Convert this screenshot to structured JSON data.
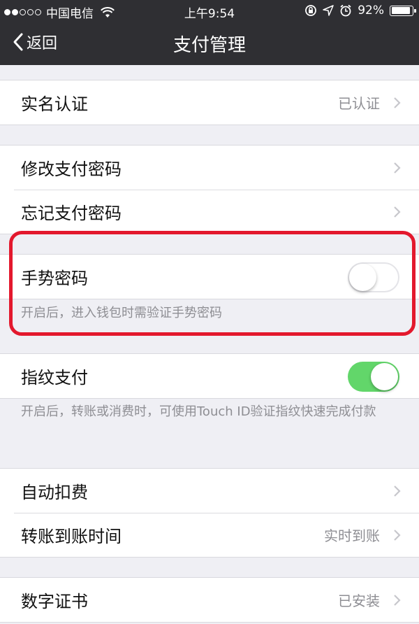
{
  "status_bar": {
    "carrier": "中国电信",
    "time": "上午9:54",
    "battery": "92%",
    "battery_level": 0.92,
    "signal_bars_filled": 2,
    "signal_bars_total": 5
  },
  "nav": {
    "back_label": "返回",
    "title": "支付管理"
  },
  "sections": {
    "realname": {
      "label": "实名认证",
      "value": "已认证"
    },
    "change_password": {
      "label": "修改支付密码"
    },
    "forgot_password": {
      "label": "忘记支付密码"
    },
    "gesture": {
      "label": "手势密码",
      "enabled": false,
      "note": "开启后，进入钱包时需验证手势密码"
    },
    "fingerprint": {
      "label": "指纹支付",
      "enabled": true,
      "note": "开启后，转账或消费时，可使用Touch ID验证指纹快速完成付款"
    },
    "auto_deduct": {
      "label": "自动扣费"
    },
    "transfer_time": {
      "label": "转账到账时间",
      "value": "实时到账"
    },
    "certificate": {
      "label": "数字证书",
      "value": "已安装"
    }
  },
  "colors": {
    "nav_background": "#2f2f33",
    "switch_on": "#62d66a",
    "highlight": "#e3182d"
  }
}
